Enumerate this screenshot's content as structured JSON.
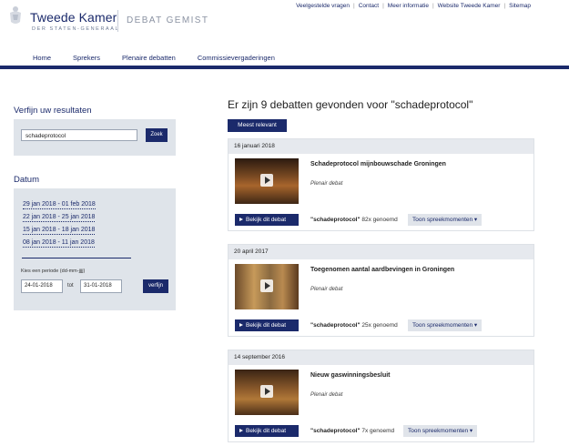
{
  "top_links": [
    "Veelgestelde vragen",
    "Contact",
    "Meer informatie",
    "Website Tweede Kamer",
    "Sitemap"
  ],
  "brand": {
    "name": "Tweede Kamer",
    "sub": "DER STATEN-GENERAAL",
    "product": "DEBAT GEMIST"
  },
  "nav": [
    "Home",
    "Sprekers",
    "Plenaire debatten",
    "Commissievergaderingen"
  ],
  "refine": {
    "title": "Verfijn uw resultaten",
    "search_value": "schadeprotocol",
    "search_button": "Zoek"
  },
  "date_filter": {
    "title": "Datum",
    "ranges": [
      "29 jan 2018 - 01 feb 2018",
      "22 jan 2018 - 25 jan 2018",
      "15 jan 2018 - 18 jan 2018",
      "08 jan 2018 - 11 jan 2018"
    ],
    "period_label": "Kies een periode (dd-mm-jjjj)",
    "from_value": "24-01-2018",
    "to_label": "tot",
    "to_value": "31-01-2018",
    "apply_button": "verfijn"
  },
  "results": {
    "heading": "Er zijn 9 debatten gevonden voor \"schadeprotocol\"",
    "sort_label": "Meest relevant",
    "items": [
      {
        "date": "16 januari 2018",
        "title": "Schadeprotocol mijnbouwschade Groningen",
        "type": "Plenair debat",
        "watch_label": "Bekijk dit debat",
        "term": "\"schadeprotocol\"",
        "mentions": "82x genoemd",
        "moments_label": "Toon spreekmomenten ▾"
      },
      {
        "date": "20 april 2017",
        "title": "Toegenomen aantal aardbevingen in Groningen",
        "type": "Plenair debat",
        "watch_label": "Bekijk dit debat",
        "term": "\"schadeprotocol\"",
        "mentions": "25x genoemd",
        "moments_label": "Toon spreekmomenten ▾"
      },
      {
        "date": "14 september 2016",
        "title": "Nieuw gaswinningsbesluit",
        "type": "Plenair debat",
        "watch_label": "Bekijk dit debat",
        "term": "\"schadeprotocol\"",
        "mentions": "7x genoemd",
        "moments_label": "Toon spreekmomenten ▾"
      }
    ]
  },
  "colors": {
    "navy": "#1b2a6b",
    "panel": "#dfe4ea"
  }
}
